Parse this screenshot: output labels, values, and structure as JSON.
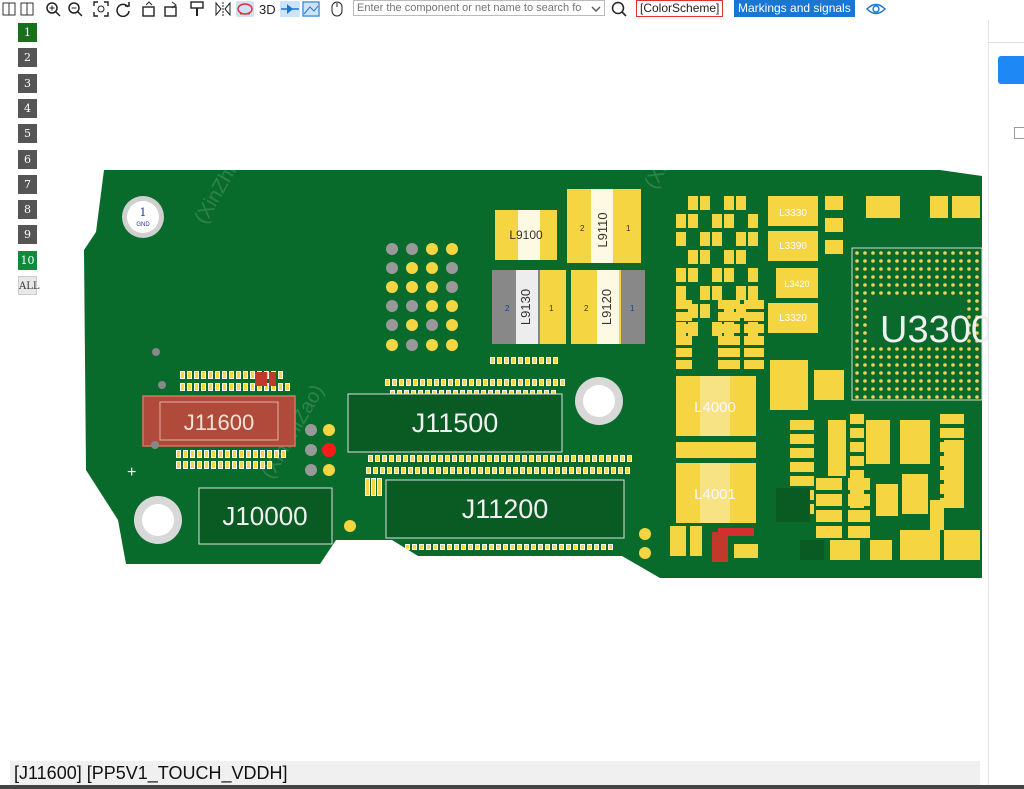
{
  "toolbar": {
    "view_3d_label": "3D",
    "search_placeholder": "Enter the component or net name to search fo",
    "color_scheme_label": "[ColorScheme]",
    "markings_label": "Markings and signals"
  },
  "layers": [
    "1",
    "2",
    "3",
    "4",
    "5",
    "6",
    "7",
    "8",
    "9",
    "10",
    "ALL"
  ],
  "board": {
    "gnd_hole_number": "1",
    "gnd_hole_label": "GND",
    "watermark": "(XinZhiZao)",
    "connectors": {
      "j11600": "J11600",
      "j11500": "J11500",
      "j11200": "J11200",
      "j10000": "J10000"
    },
    "inductors": {
      "l9100": "L9100",
      "l9110": "L9110",
      "l9130": "L9130",
      "l9120": "L9120",
      "l4000": "L4000",
      "l4001": "L4001",
      "l3330": "L3330",
      "l3390": "L3390",
      "l3420": "L3420",
      "l3320": "L3320"
    },
    "chips": {
      "u3300": "U3300"
    },
    "pad_pin_1": "1",
    "pad_pin_2": "2"
  },
  "status": {
    "text": "[J11600] [PP5V1_TOUCH_VDDH]"
  },
  "colors": {
    "board_green": "#086b2b",
    "pad_yellow": "#f5d542",
    "highlight_red": "#c0392b",
    "accent_blue": "#1976d2"
  }
}
